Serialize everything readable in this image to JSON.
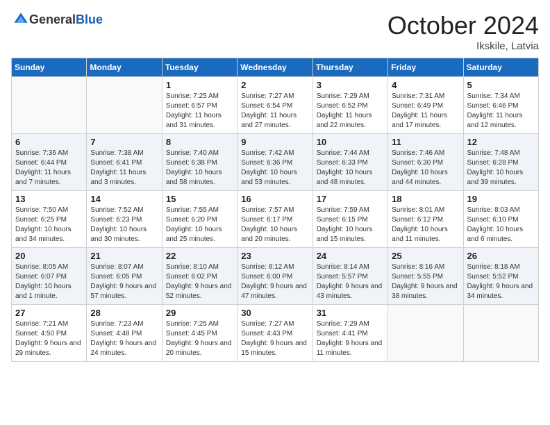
{
  "header": {
    "logo_general": "General",
    "logo_blue": "Blue",
    "month": "October 2024",
    "location": "Ikskile, Latvia"
  },
  "weekdays": [
    "Sunday",
    "Monday",
    "Tuesday",
    "Wednesday",
    "Thursday",
    "Friday",
    "Saturday"
  ],
  "weeks": [
    [
      {
        "day": "",
        "info": ""
      },
      {
        "day": "",
        "info": ""
      },
      {
        "day": "1",
        "info": "Sunrise: 7:25 AM\nSunset: 6:57 PM\nDaylight: 11 hours and 31 minutes."
      },
      {
        "day": "2",
        "info": "Sunrise: 7:27 AM\nSunset: 6:54 PM\nDaylight: 11 hours and 27 minutes."
      },
      {
        "day": "3",
        "info": "Sunrise: 7:29 AM\nSunset: 6:52 PM\nDaylight: 11 hours and 22 minutes."
      },
      {
        "day": "4",
        "info": "Sunrise: 7:31 AM\nSunset: 6:49 PM\nDaylight: 11 hours and 17 minutes."
      },
      {
        "day": "5",
        "info": "Sunrise: 7:34 AM\nSunset: 6:46 PM\nDaylight: 11 hours and 12 minutes."
      }
    ],
    [
      {
        "day": "6",
        "info": "Sunrise: 7:36 AM\nSunset: 6:44 PM\nDaylight: 11 hours and 7 minutes."
      },
      {
        "day": "7",
        "info": "Sunrise: 7:38 AM\nSunset: 6:41 PM\nDaylight: 11 hours and 3 minutes."
      },
      {
        "day": "8",
        "info": "Sunrise: 7:40 AM\nSunset: 6:38 PM\nDaylight: 10 hours and 58 minutes."
      },
      {
        "day": "9",
        "info": "Sunrise: 7:42 AM\nSunset: 6:36 PM\nDaylight: 10 hours and 53 minutes."
      },
      {
        "day": "10",
        "info": "Sunrise: 7:44 AM\nSunset: 6:33 PM\nDaylight: 10 hours and 48 minutes."
      },
      {
        "day": "11",
        "info": "Sunrise: 7:46 AM\nSunset: 6:30 PM\nDaylight: 10 hours and 44 minutes."
      },
      {
        "day": "12",
        "info": "Sunrise: 7:48 AM\nSunset: 6:28 PM\nDaylight: 10 hours and 39 minutes."
      }
    ],
    [
      {
        "day": "13",
        "info": "Sunrise: 7:50 AM\nSunset: 6:25 PM\nDaylight: 10 hours and 34 minutes."
      },
      {
        "day": "14",
        "info": "Sunrise: 7:52 AM\nSunset: 6:23 PM\nDaylight: 10 hours and 30 minutes."
      },
      {
        "day": "15",
        "info": "Sunrise: 7:55 AM\nSunset: 6:20 PM\nDaylight: 10 hours and 25 minutes."
      },
      {
        "day": "16",
        "info": "Sunrise: 7:57 AM\nSunset: 6:17 PM\nDaylight: 10 hours and 20 minutes."
      },
      {
        "day": "17",
        "info": "Sunrise: 7:59 AM\nSunset: 6:15 PM\nDaylight: 10 hours and 15 minutes."
      },
      {
        "day": "18",
        "info": "Sunrise: 8:01 AM\nSunset: 6:12 PM\nDaylight: 10 hours and 11 minutes."
      },
      {
        "day": "19",
        "info": "Sunrise: 8:03 AM\nSunset: 6:10 PM\nDaylight: 10 hours and 6 minutes."
      }
    ],
    [
      {
        "day": "20",
        "info": "Sunrise: 8:05 AM\nSunset: 6:07 PM\nDaylight: 10 hours and 1 minute."
      },
      {
        "day": "21",
        "info": "Sunrise: 8:07 AM\nSunset: 6:05 PM\nDaylight: 9 hours and 57 minutes."
      },
      {
        "day": "22",
        "info": "Sunrise: 8:10 AM\nSunset: 6:02 PM\nDaylight: 9 hours and 52 minutes."
      },
      {
        "day": "23",
        "info": "Sunrise: 8:12 AM\nSunset: 6:00 PM\nDaylight: 9 hours and 47 minutes."
      },
      {
        "day": "24",
        "info": "Sunrise: 8:14 AM\nSunset: 5:57 PM\nDaylight: 9 hours and 43 minutes."
      },
      {
        "day": "25",
        "info": "Sunrise: 8:16 AM\nSunset: 5:55 PM\nDaylight: 9 hours and 38 minutes."
      },
      {
        "day": "26",
        "info": "Sunrise: 8:18 AM\nSunset: 5:52 PM\nDaylight: 9 hours and 34 minutes."
      }
    ],
    [
      {
        "day": "27",
        "info": "Sunrise: 7:21 AM\nSunset: 4:50 PM\nDaylight: 9 hours and 29 minutes."
      },
      {
        "day": "28",
        "info": "Sunrise: 7:23 AM\nSunset: 4:48 PM\nDaylight: 9 hours and 24 minutes."
      },
      {
        "day": "29",
        "info": "Sunrise: 7:25 AM\nSunset: 4:45 PM\nDaylight: 9 hours and 20 minutes."
      },
      {
        "day": "30",
        "info": "Sunrise: 7:27 AM\nSunset: 4:43 PM\nDaylight: 9 hours and 15 minutes."
      },
      {
        "day": "31",
        "info": "Sunrise: 7:29 AM\nSunset: 4:41 PM\nDaylight: 9 hours and 11 minutes."
      },
      {
        "day": "",
        "info": ""
      },
      {
        "day": "",
        "info": ""
      }
    ]
  ]
}
